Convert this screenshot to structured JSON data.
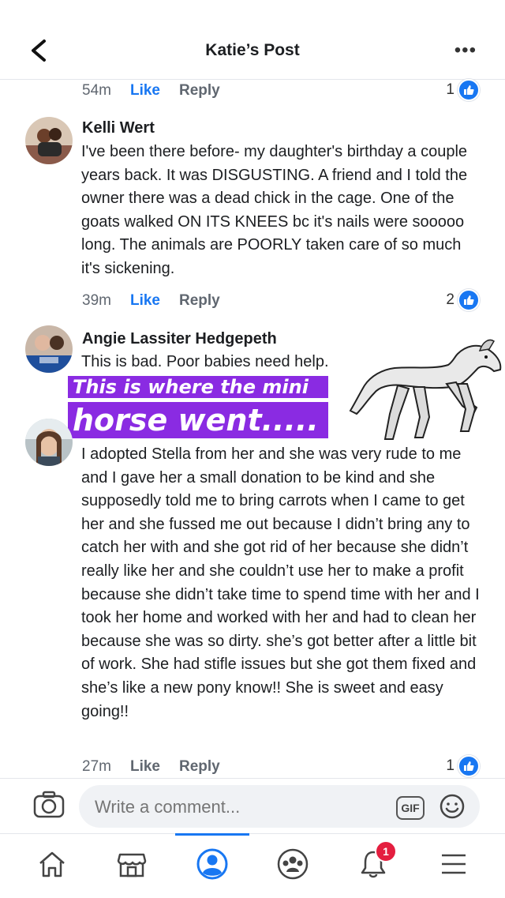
{
  "header": {
    "title": "Katie’s Post"
  },
  "comments": [
    {
      "time": "54m",
      "like": "Like",
      "reply": "Reply",
      "reactions": "1"
    },
    {
      "name": "Kelli Wert",
      "text": "I've been there before- my daughter's birthday a couple years back. It was DISGUSTING. A friend and I told the owner there was a dead chick in the cage. One of the goats walked ON ITS KNEES bc it's nails were sooooo long. The animals are POORLY taken care of so much it's sickening.",
      "time": "39m",
      "like": "Like",
      "reply": "Reply",
      "reactions": "2"
    },
    {
      "name": "Angie Lassiter Hedgepeth",
      "text": "This is bad. Poor babies need help."
    },
    {
      "text": "I adopted Stella from her and she was very rude to me and I gave her a small donation to be kind and she supposedly told me to bring carrots when I came to get her and she fussed me out because I didn’t bring any to catch her with and she got rid of her because she didn’t really like her and she couldn’t use her to make a profit because she didn’t take time to spend time with her and I took her home and worked with her and had to clean her because she was so dirty. she’s got better after a little bit of work. She had stifle issues but she got them fixed and she’s like a new pony know!! She is sweet and easy going!!",
      "time": "27m",
      "like": "Like",
      "reply": "Reply",
      "reactions": "1"
    }
  ],
  "overlay": {
    "line1": "This is where the mini",
    "line2": "horse went....."
  },
  "composer": {
    "placeholder": "Write a comment...",
    "gif_label": "GIF"
  },
  "tabbar": {
    "icons": [
      "home-icon",
      "marketplace-icon",
      "profile-icon",
      "groups-icon",
      "notifications-icon",
      "menu-icon"
    ],
    "notification_count": "1"
  },
  "colors": {
    "accent": "#1877f2",
    "sticker": "#8a2be2",
    "badge": "#e41e3f"
  }
}
